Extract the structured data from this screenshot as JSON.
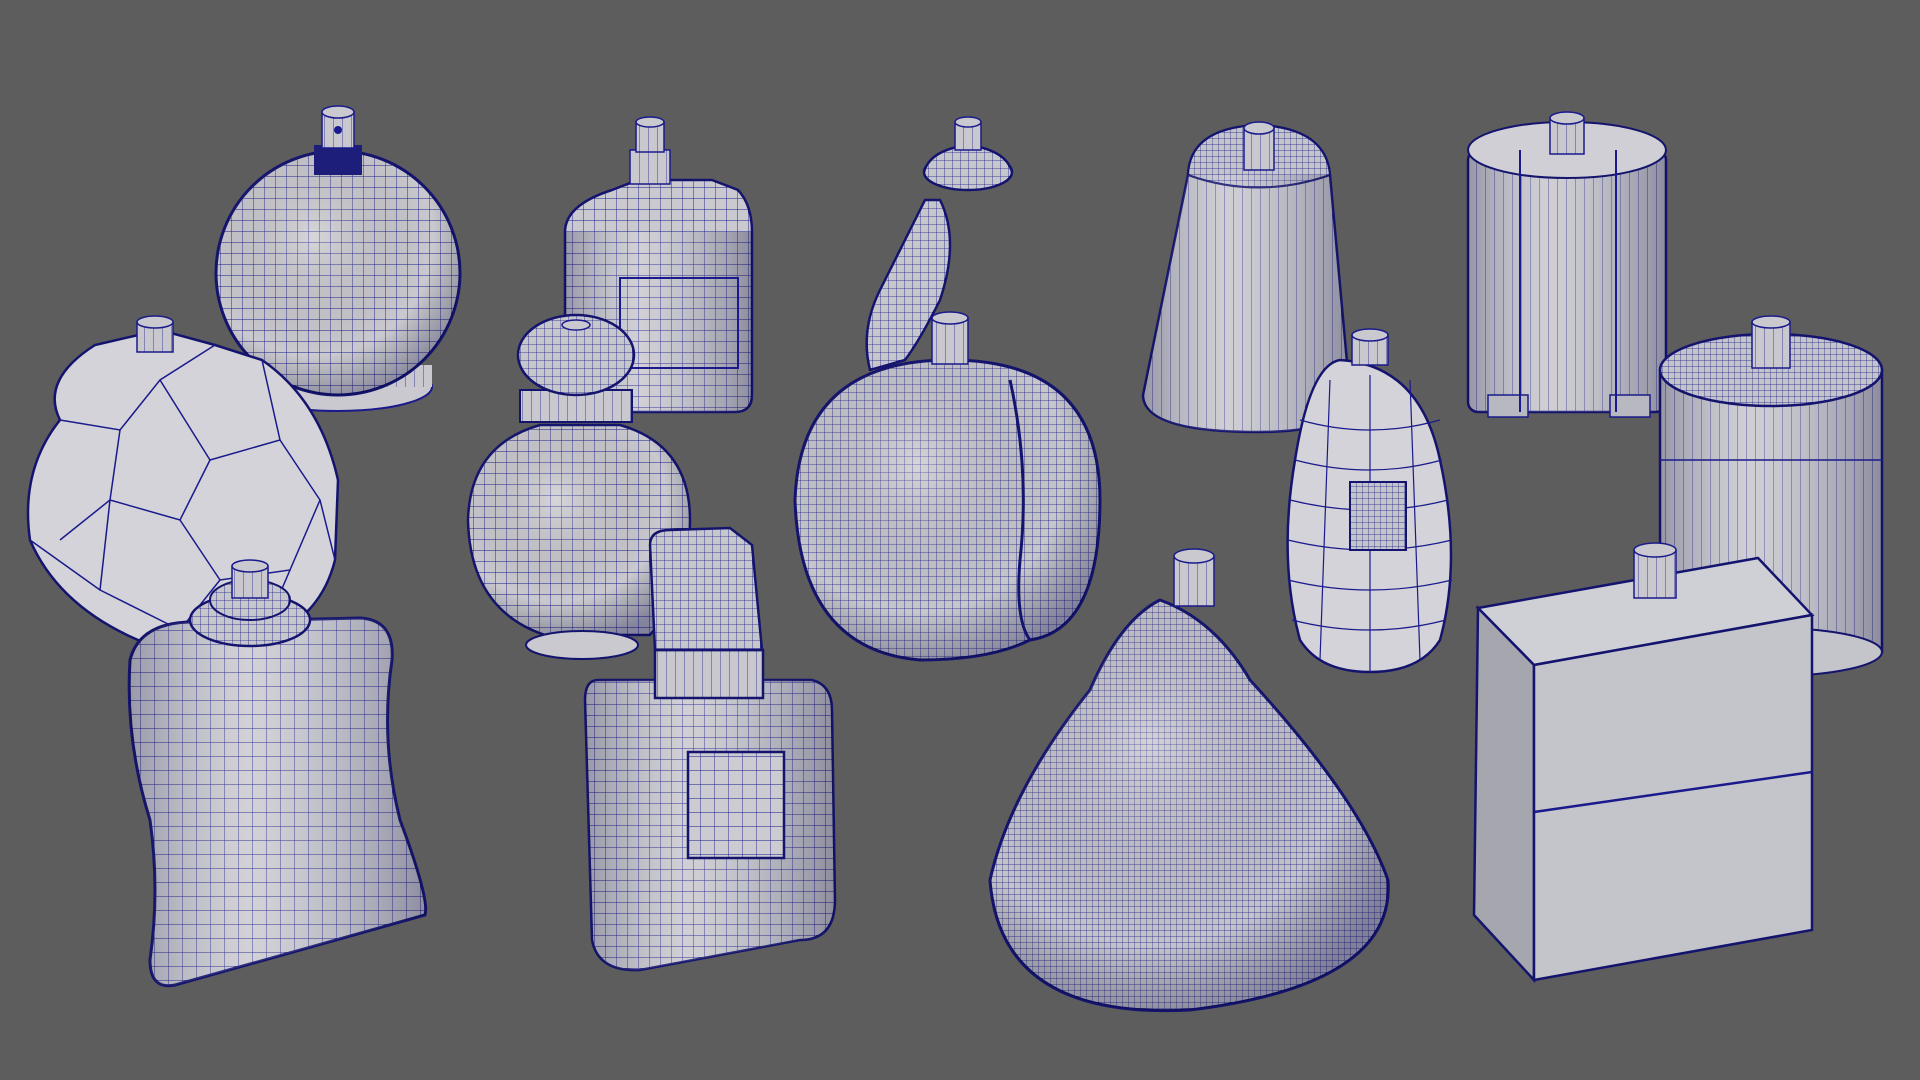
{
  "viewport": {
    "background": "#5d5d5d"
  },
  "palette": {
    "wire": "#1a1a8c",
    "wire_dense": "#14146e",
    "surface": "#c9c9cf",
    "surface_light": "#d9d9de",
    "surface_dark": "#a9a9b0",
    "shadow": "#4f4f55"
  },
  "objects": [
    {
      "name": "round-bottle",
      "shape": "sphere"
    },
    {
      "name": "flask-bottle",
      "shape": "flask"
    },
    {
      "name": "curved-neck-bottle",
      "shape": "curved-neck"
    },
    {
      "name": "bell-bottle",
      "shape": "bell"
    },
    {
      "name": "ribbed-cylinder-bottle",
      "shape": "finned-cylinder"
    },
    {
      "name": "faceted-rock-bottle",
      "shape": "faceted"
    },
    {
      "name": "urn-bottle",
      "shape": "urn"
    },
    {
      "name": "apple-bottle",
      "shape": "apple"
    },
    {
      "name": "scaled-bottle",
      "shape": "scaled"
    },
    {
      "name": "tall-cylinder-bottle",
      "shape": "cylinder"
    },
    {
      "name": "curvy-square-bottle",
      "shape": "curvy-box"
    },
    {
      "name": "capped-square-bottle",
      "shape": "capped-box"
    },
    {
      "name": "cone-bottle",
      "shape": "cone"
    },
    {
      "name": "rectangular-box-bottle",
      "shape": "box"
    }
  ]
}
